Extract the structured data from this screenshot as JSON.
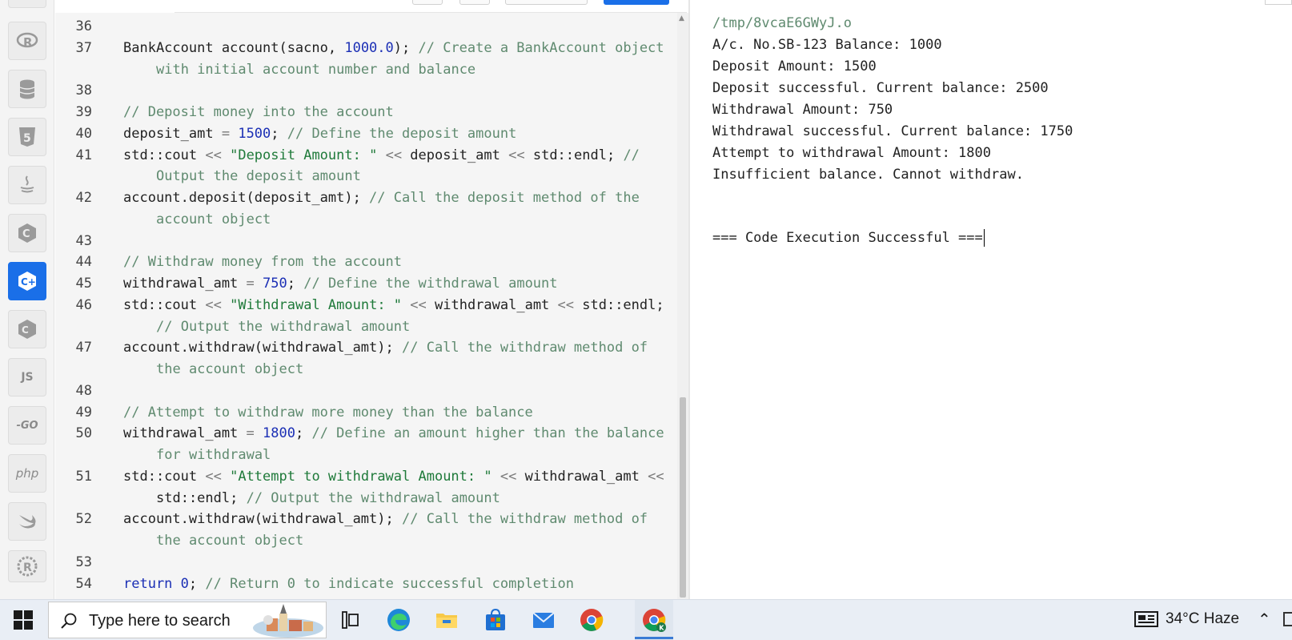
{
  "sidebar": {
    "languages": [
      {
        "name": "r",
        "label": "R"
      },
      {
        "name": "sql",
        "label": ""
      },
      {
        "name": "html5",
        "label": "5"
      },
      {
        "name": "java",
        "label": ""
      },
      {
        "name": "c",
        "label": "C"
      },
      {
        "name": "cpp",
        "label": "C+",
        "active": true
      },
      {
        "name": "csharp",
        "label": "C#"
      },
      {
        "name": "javascript",
        "label": "JS"
      },
      {
        "name": "go",
        "label": "-GO"
      },
      {
        "name": "php",
        "label": "php"
      },
      {
        "name": "swift",
        "label": ""
      },
      {
        "name": "rust",
        "label": "R"
      }
    ]
  },
  "editor": {
    "lines": [
      {
        "n": "36",
        "parts": []
      },
      {
        "n": "37",
        "parts": [
          {
            "t": "BankAccount account(sacno, "
          },
          {
            "t": "1000.0",
            "c": "num"
          },
          {
            "t": "); "
          },
          {
            "t": "// Create a BankAccount object",
            "c": "cm"
          }
        ]
      },
      {
        "n": "",
        "cont": true,
        "parts": [
          {
            "t": "with initial account number and balance",
            "c": "cm"
          }
        ]
      },
      {
        "n": "38",
        "parts": []
      },
      {
        "n": "39",
        "parts": [
          {
            "t": "// Deposit money into the account",
            "c": "cm"
          }
        ]
      },
      {
        "n": "40",
        "parts": [
          {
            "t": "deposit_amt "
          },
          {
            "t": "=",
            "c": "op"
          },
          {
            "t": " "
          },
          {
            "t": "1500",
            "c": "num"
          },
          {
            "t": "; "
          },
          {
            "t": "// Define the deposit amount",
            "c": "cm"
          }
        ]
      },
      {
        "n": "41",
        "parts": [
          {
            "t": "std::cout "
          },
          {
            "t": "<<",
            "c": "op"
          },
          {
            "t": " "
          },
          {
            "t": "\"Deposit Amount: \"",
            "c": "str"
          },
          {
            "t": " "
          },
          {
            "t": "<<",
            "c": "op"
          },
          {
            "t": " deposit_amt "
          },
          {
            "t": "<<",
            "c": "op"
          },
          {
            "t": " std::endl; "
          },
          {
            "t": "//",
            "c": "cm"
          }
        ]
      },
      {
        "n": "",
        "cont": true,
        "parts": [
          {
            "t": "Output the deposit amount",
            "c": "cm"
          }
        ]
      },
      {
        "n": "42",
        "parts": [
          {
            "t": "account.deposit(deposit_amt); "
          },
          {
            "t": "// Call the deposit method of the",
            "c": "cm"
          }
        ]
      },
      {
        "n": "",
        "cont": true,
        "parts": [
          {
            "t": "account object",
            "c": "cm"
          }
        ]
      },
      {
        "n": "43",
        "parts": []
      },
      {
        "n": "44",
        "parts": [
          {
            "t": "// Withdraw money from the account",
            "c": "cm"
          }
        ]
      },
      {
        "n": "45",
        "parts": [
          {
            "t": "withdrawal_amt "
          },
          {
            "t": "=",
            "c": "op"
          },
          {
            "t": " "
          },
          {
            "t": "750",
            "c": "num"
          },
          {
            "t": "; "
          },
          {
            "t": "// Define the withdrawal amount",
            "c": "cm"
          }
        ]
      },
      {
        "n": "46",
        "parts": [
          {
            "t": "std::cout "
          },
          {
            "t": "<<",
            "c": "op"
          },
          {
            "t": " "
          },
          {
            "t": "\"Withdrawal Amount: \"",
            "c": "str"
          },
          {
            "t": " "
          },
          {
            "t": "<<",
            "c": "op"
          },
          {
            "t": " withdrawal_amt "
          },
          {
            "t": "<<",
            "c": "op"
          },
          {
            "t": " std::endl;"
          }
        ]
      },
      {
        "n": "",
        "cont": true,
        "parts": [
          {
            "t": "// Output the withdrawal amount",
            "c": "cm"
          }
        ]
      },
      {
        "n": "47",
        "parts": [
          {
            "t": "account.withdraw(withdrawal_amt); "
          },
          {
            "t": "// Call the withdraw method of",
            "c": "cm"
          }
        ]
      },
      {
        "n": "",
        "cont": true,
        "parts": [
          {
            "t": "the account object",
            "c": "cm"
          }
        ]
      },
      {
        "n": "48",
        "parts": []
      },
      {
        "n": "49",
        "parts": [
          {
            "t": "// Attempt to withdraw more money than the balance",
            "c": "cm"
          }
        ]
      },
      {
        "n": "50",
        "parts": [
          {
            "t": "withdrawal_amt "
          },
          {
            "t": "=",
            "c": "op"
          },
          {
            "t": " "
          },
          {
            "t": "1800",
            "c": "num"
          },
          {
            "t": "; "
          },
          {
            "t": "// Define an amount higher than the balance",
            "c": "cm"
          }
        ]
      },
      {
        "n": "",
        "cont": true,
        "parts": [
          {
            "t": "for withdrawal",
            "c": "cm"
          }
        ]
      },
      {
        "n": "51",
        "parts": [
          {
            "t": "std::cout "
          },
          {
            "t": "<<",
            "c": "op"
          },
          {
            "t": " "
          },
          {
            "t": "\"Attempt to withdrawal Amount: \"",
            "c": "str"
          },
          {
            "t": " "
          },
          {
            "t": "<<",
            "c": "op"
          },
          {
            "t": " withdrawal_amt "
          },
          {
            "t": "<<",
            "c": "op"
          }
        ]
      },
      {
        "n": "",
        "cont": true,
        "parts": [
          {
            "t": "std::endl; "
          },
          {
            "t": "// Output the withdrawal amount",
            "c": "cm"
          }
        ]
      },
      {
        "n": "52",
        "parts": [
          {
            "t": "account.withdraw(withdrawal_amt); "
          },
          {
            "t": "// Call the withdraw method of",
            "c": "cm"
          }
        ]
      },
      {
        "n": "",
        "cont": true,
        "parts": [
          {
            "t": "the account object",
            "c": "cm"
          }
        ]
      },
      {
        "n": "53",
        "parts": []
      },
      {
        "n": "54",
        "parts": [
          {
            "t": "return",
            "c": "num"
          },
          {
            "t": " "
          },
          {
            "t": "0",
            "c": "num"
          },
          {
            "t": "; "
          },
          {
            "t": "// Return 0 to indicate successful completion",
            "c": "cm"
          }
        ]
      }
    ]
  },
  "output": {
    "path": "/tmp/8vcaE6GWyJ.o",
    "lines": [
      "A/c. No.SB-123 Balance: 1000",
      "Deposit Amount: 1500",
      "Deposit successful. Current balance: 2500",
      "Withdrawal Amount: 750",
      "Withdrawal successful. Current balance: 1750",
      "Attempt to withdrawal Amount: 1800",
      "Insufficient balance. Cannot withdraw."
    ],
    "status": "=== Code Execution Successful ==="
  },
  "taskbar": {
    "search_placeholder": "Type here to search",
    "apps": [
      "task-view",
      "edge",
      "file-explorer",
      "microsoft-store",
      "mail",
      "chrome",
      "chrome-profile"
    ],
    "weather": "34°C  Haze",
    "colors": {
      "accent": "#1a6fe8"
    }
  }
}
